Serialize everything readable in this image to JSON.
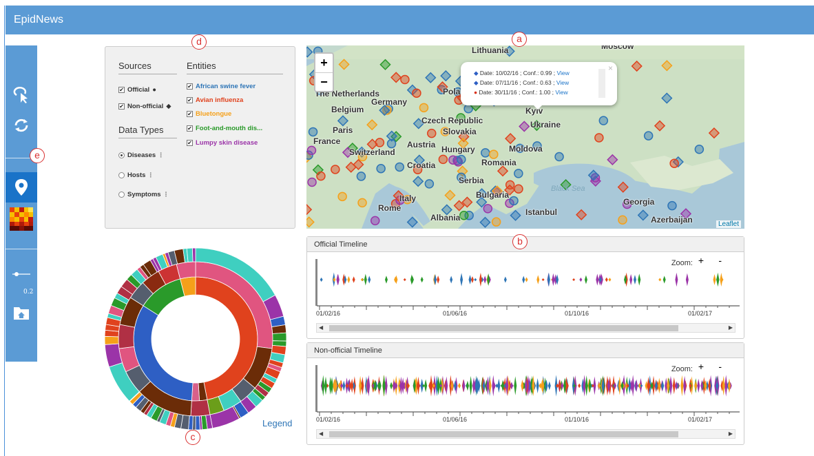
{
  "app": {
    "title": "EpidNews"
  },
  "sidebar": {
    "items": [
      {
        "icon": "pointer-select-icon"
      },
      {
        "icon": "refresh-icon"
      },
      {
        "icon": "map-marker-icon",
        "active": true
      },
      {
        "icon": "heatmap-icon"
      },
      {
        "icon": "slider-icon"
      },
      {
        "icon": "home-folder-icon"
      }
    ],
    "slider_value": "0.2"
  },
  "filters": {
    "sources_header": "Sources",
    "entities_header": "Entities",
    "data_types_header": "Data Types",
    "sources": [
      {
        "label": "Official",
        "checked": true,
        "marker": "●"
      },
      {
        "label": "Non-official",
        "checked": true,
        "marker": "◆"
      }
    ],
    "entities": [
      {
        "label": "African swine fever",
        "checked": true,
        "color": "#2e75b6"
      },
      {
        "label": "Avian influenza",
        "checked": true,
        "color": "#e0421d"
      },
      {
        "label": "Bluetongue",
        "checked": true,
        "color": "#f5a01a"
      },
      {
        "label": "Foot-and-mouth dis...",
        "checked": true,
        "color": "#2a9a2a"
      },
      {
        "label": "Lumpy skin disease",
        "checked": true,
        "color": "#9b34a8"
      }
    ],
    "data_types": [
      {
        "label": "Diseases",
        "selected": true
      },
      {
        "label": "Hosts",
        "selected": false
      },
      {
        "label": "Symptoms",
        "selected": false
      }
    ]
  },
  "map": {
    "zoom_in": "+",
    "zoom_out": "−",
    "attribution": "Leaflet",
    "labels": [
      "Lithuania",
      "Moscow",
      "The Netherlands",
      "Pola",
      "Germany",
      "Belgium",
      "Czech Republic",
      "Kyiv",
      "Ukraine",
      "Paris",
      "Slovakia",
      "France",
      "Austria",
      "Switzerland",
      "Hungary",
      "Moldova",
      "Croatia",
      "Romania",
      "Serbia",
      "Bulgaria",
      "Italy",
      "Rome",
      "Albania",
      "Istanbul",
      "Georgia",
      "Azerbaijan"
    ],
    "sea_label": "Black Sea",
    "popup": {
      "lines": [
        {
          "marker": "◆",
          "marker_color": "#2e5fc4",
          "text": "Date: 10/02/16 ; Conf.: 0.99 ; ",
          "link": "View"
        },
        {
          "marker": "◆",
          "marker_color": "#2e5fc4",
          "text": "Date: 07/11/16 ; Conf.: 0.63 ; ",
          "link": "View"
        },
        {
          "marker": "●",
          "marker_color": "#d9301a",
          "text": "Date: 30/11/16 ; Conf.: 1.00 ; ",
          "link": "View"
        }
      ],
      "close": "×"
    }
  },
  "timelines": {
    "official": {
      "title": "Official Timeline",
      "zoom_label": "Zoom:",
      "zoom_in": "+",
      "zoom_out": "-",
      "ticks": [
        "01/02/16",
        "01/06/16",
        "01/10/16",
        "01/02/17"
      ]
    },
    "nonofficial": {
      "title": "Non-official Timeline",
      "zoom_label": "Zoom:",
      "zoom_in": "+",
      "zoom_out": "-",
      "ticks": [
        "01/02/16",
        "01/06/16",
        "01/10/16",
        "01/02/17"
      ]
    }
  },
  "sunburst": {
    "legend_link": "Legend"
  },
  "callouts": {
    "a": "a",
    "b": "b",
    "c": "c",
    "d": "d",
    "e": "e"
  }
}
